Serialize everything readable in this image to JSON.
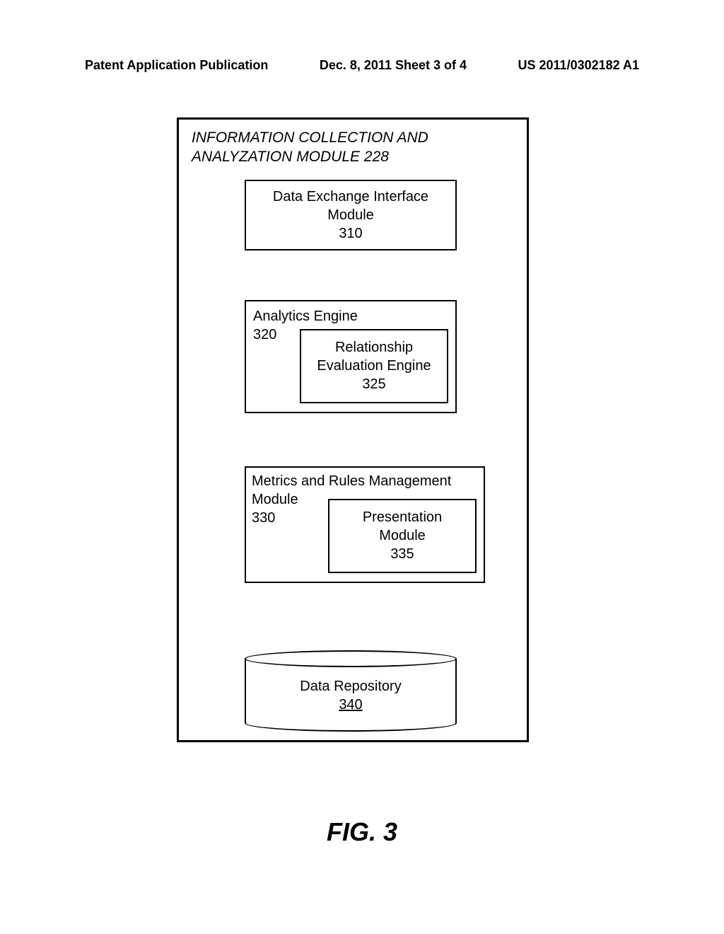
{
  "header": {
    "left": "Patent Application Publication",
    "center": "Dec. 8, 2011 Sheet 3 of 4",
    "right": "US 2011/0302182 A1"
  },
  "module": {
    "title": "INFORMATION COLLECTION AND ANALYZATION MODULE 228",
    "dataExchange": {
      "line1": "Data Exchange Interface",
      "line2": "Module",
      "number": "310"
    },
    "analytics": {
      "label": "Analytics Engine",
      "number": "320",
      "nested": {
        "line1": "Relationship",
        "line2": "Evaluation Engine",
        "number": "325"
      }
    },
    "metrics": {
      "label": "Metrics and Rules Management",
      "label2": "Module",
      "number": "330",
      "nested": {
        "line1": "Presentation",
        "line2": "Module",
        "number": "335"
      }
    },
    "repository": {
      "label": "Data Repository",
      "number": "340"
    }
  },
  "figureLabel": "FIG. 3"
}
